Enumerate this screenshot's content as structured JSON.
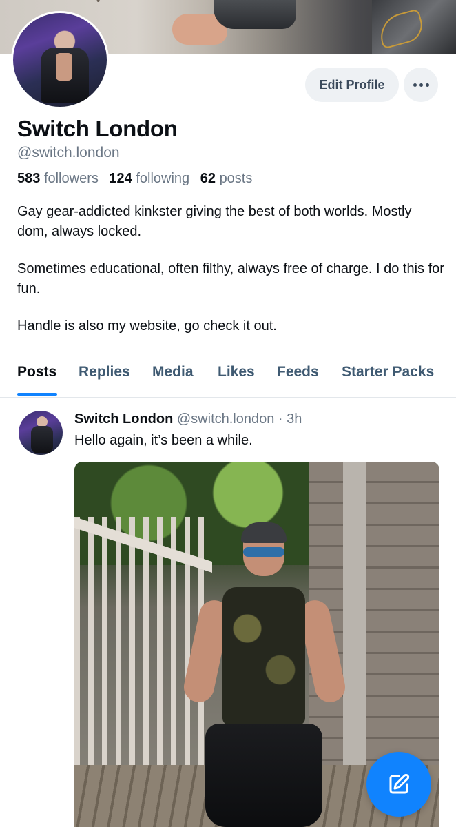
{
  "profile": {
    "display_name": "Switch London",
    "handle": "@switch.london",
    "stats": {
      "followers_count": "583",
      "followers_label": "followers",
      "following_count": "124",
      "following_label": "following",
      "posts_count": "62",
      "posts_label": "posts"
    },
    "bio": {
      "line1": "Gay gear-addicted kinkster giving the best of both worlds. Mostly dom, always locked.",
      "line2": "Sometimes educational, often filthy, always free of charge. I do this for fun.",
      "line3": "Handle is also my website, go check it out."
    }
  },
  "actions": {
    "edit_profile_label": "Edit Profile",
    "more_icon": "ellipsis-icon"
  },
  "tabs": [
    {
      "label": "Posts",
      "active": true
    },
    {
      "label": "Replies",
      "active": false
    },
    {
      "label": "Media",
      "active": false
    },
    {
      "label": "Likes",
      "active": false
    },
    {
      "label": "Feeds",
      "active": false
    },
    {
      "label": "Starter Packs",
      "active": false
    }
  ],
  "post": {
    "author_name": "Switch London",
    "author_handle": "@switch.london",
    "separator": "·",
    "time": "3h",
    "text": "Hello again, it’s been a while."
  },
  "fab": {
    "icon": "compose-icon"
  },
  "colors": {
    "accent": "#1083fe",
    "muted_text": "#6b7785",
    "tab_text": "#3f5a72",
    "button_bg": "#eef1f4"
  }
}
